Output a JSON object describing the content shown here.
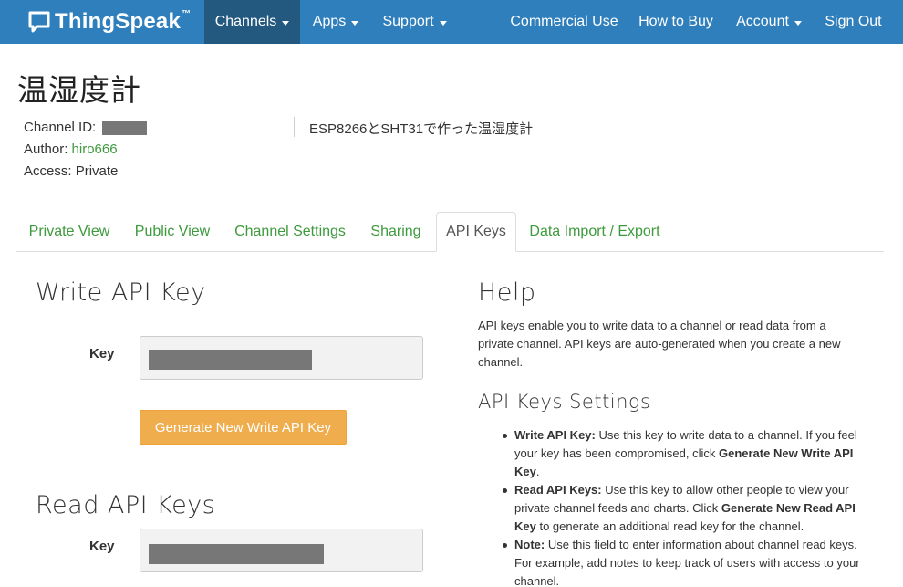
{
  "navbar": {
    "brand": "ThingSpeak",
    "brand_tm": "™",
    "items": [
      {
        "label": "Channels",
        "dropdown": true,
        "active": true
      },
      {
        "label": "Apps",
        "dropdown": true
      },
      {
        "label": "Support",
        "dropdown": true
      },
      {
        "label": "Commercial Use"
      },
      {
        "label": "How to Buy"
      },
      {
        "label": "Account",
        "dropdown": true
      },
      {
        "label": "Sign Out"
      }
    ]
  },
  "channel": {
    "title": "温湿度計",
    "id_label": "Channel ID:",
    "author_label": "Author:",
    "author": "hiro666",
    "access_label": "Access:",
    "access": "Private",
    "description": "ESP8266とSHT31で作った温湿度計"
  },
  "tabs": [
    {
      "label": "Private View"
    },
    {
      "label": "Public View"
    },
    {
      "label": "Channel Settings"
    },
    {
      "label": "Sharing"
    },
    {
      "label": "API Keys",
      "active": true
    },
    {
      "label": "Data Import / Export"
    }
  ],
  "write": {
    "title": "Write API Key",
    "key_label": "Key",
    "generate_label": "Generate New Write API Key"
  },
  "read": {
    "title": "Read API Keys",
    "key_label": "Key"
  },
  "help": {
    "title": "Help",
    "intro": "API keys enable you to write data to a channel or read data from a private channel. API keys are auto-generated when you create a new channel.",
    "settings_title": "API Keys Settings",
    "items": [
      {
        "bold1": "Write API Key:",
        "text1": " Use this key to write data to a channel. If you feel your key has been compromised, click ",
        "bold2": "Generate New Write API Key",
        "text2": "."
      },
      {
        "bold1": "Read API Keys:",
        "text1": " Use this key to allow other people to view your private channel feeds and charts. Click ",
        "bold2": "Generate New Read API Key",
        "text2": " to generate an additional read key for the channel."
      },
      {
        "bold1": "Note:",
        "text1": " Use this field to enter information about channel read keys. For example, add notes to keep track of users with access to your channel.",
        "bold2": "",
        "text2": ""
      }
    ]
  },
  "colors": {
    "navbar": "#2f7fbd",
    "navbar_active": "#23587f",
    "link": "#3d9a3d",
    "button": "#f0ad4e",
    "redaction": "#777777"
  }
}
